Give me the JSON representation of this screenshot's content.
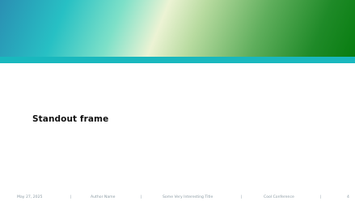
{
  "slide": {
    "title": "Standout frame"
  },
  "footer": {
    "date": "May 27, 2025",
    "author": "Author Name",
    "presentation_title": "Some Very Interesting Title",
    "conference": "Cool Conference",
    "page": "4",
    "separator": "|"
  },
  "colors": {
    "banner_gradient": [
      "#2a8fb3",
      "#27c0c4",
      "#ecf3d4",
      "#087d10"
    ],
    "banner_rule": "#19b8be",
    "title_text": "#111111",
    "footer_text": "#8a9aa3"
  }
}
